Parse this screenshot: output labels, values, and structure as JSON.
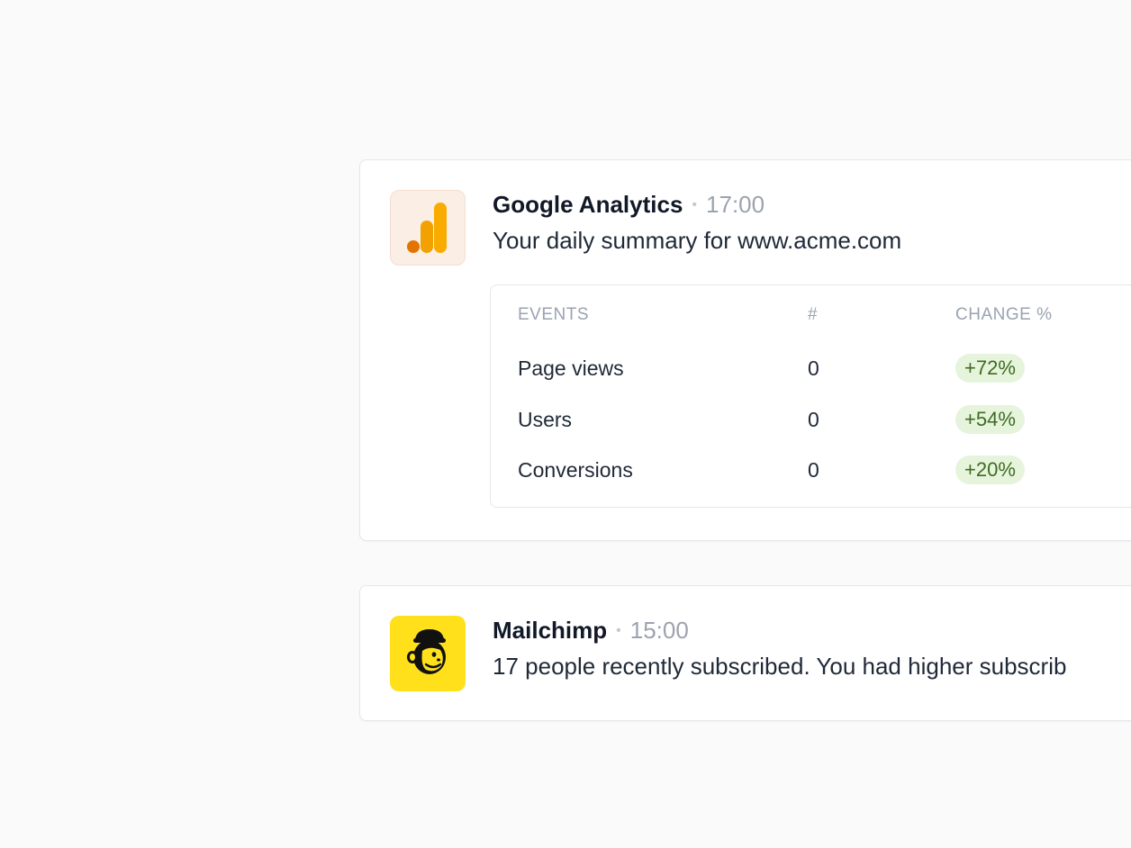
{
  "notifications": [
    {
      "app": "Google Analytics",
      "time": "17:00",
      "message": "Your daily summary for www.acme.com",
      "icon": "google-analytics-bar-icon",
      "icon_colors": {
        "bg": "#fbeee4",
        "bar_light": "#f9ab00",
        "bar_dark": "#e37400"
      },
      "table": {
        "headers": [
          "EVENTS",
          "#",
          "CHANGE %"
        ],
        "rows": [
          {
            "event": "Page views",
            "count": "0",
            "change": "+72%"
          },
          {
            "event": "Users",
            "count": "0",
            "change": "+54%"
          },
          {
            "event": "Conversions",
            "count": "0",
            "change": "+20%"
          }
        ]
      }
    },
    {
      "app": "Mailchimp",
      "time": "15:00",
      "message": "17 people recently subscribed. You had higher subscrib",
      "icon": "mailchimp-freddie-icon",
      "icon_colors": {
        "bg": "#ffe01b"
      }
    }
  ],
  "colors": {
    "badge_bg": "#e6f4dc",
    "badge_text": "#3f6b23",
    "muted": "#9ca3af"
  }
}
